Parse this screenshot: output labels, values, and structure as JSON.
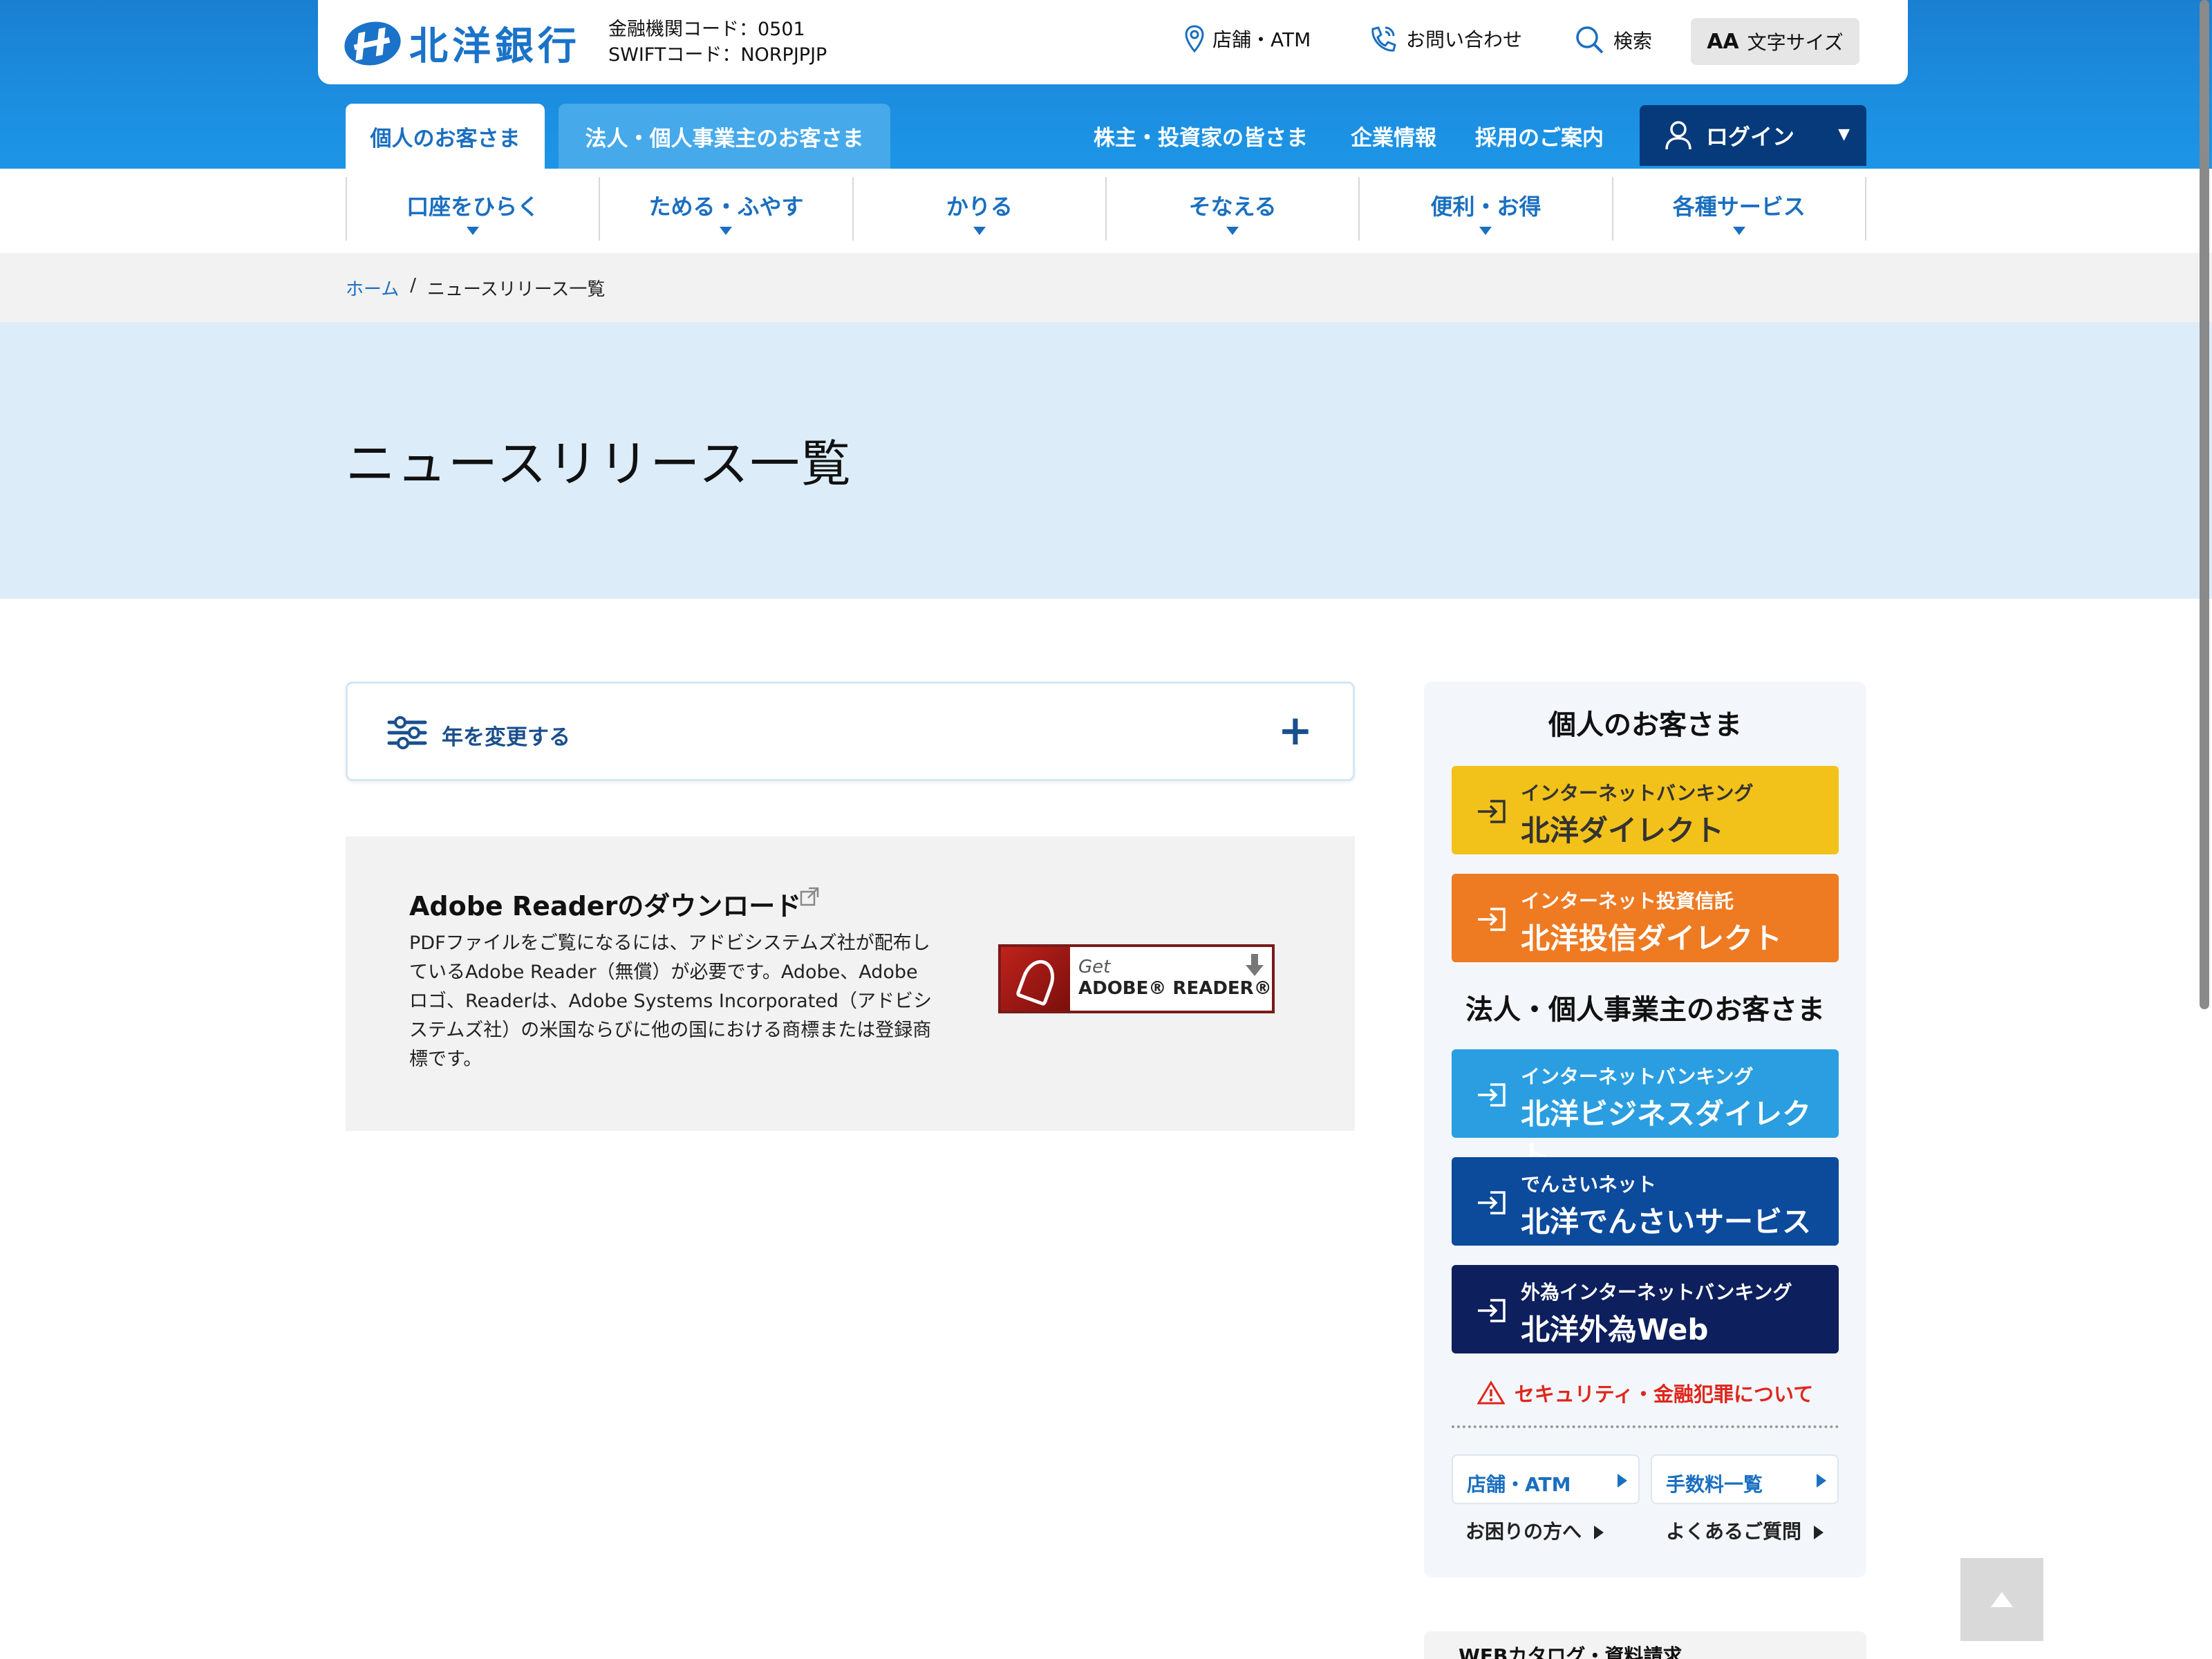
{
  "header": {
    "logo_text": "北洋銀行",
    "bank_code": "金融機関コード：0501",
    "swift_code": "SWIFTコード：NORPJPJP",
    "util_store": "店舗・ATM",
    "util_contact": "お問い合わせ",
    "util_search": "検索",
    "util_fontsize_aa": "AA",
    "util_fontsize": "文字サイズ"
  },
  "tabs": {
    "personal": "個人のお客さま",
    "corporate": "法人・個人事業主のお客さま"
  },
  "toplinks": {
    "investors": "株主・投資家の皆さま",
    "company": "企業情報",
    "recruit": "採用のご案内",
    "login": "ログイン"
  },
  "gnav": [
    {
      "label": "口座をひらく"
    },
    {
      "label": "ためる・ふやす"
    },
    {
      "label": "かりる"
    },
    {
      "label": "そなえる"
    },
    {
      "label": "便利・お得"
    },
    {
      "label": "各種サービス"
    }
  ],
  "breadcrumb": {
    "home": "ホーム",
    "sep": "/",
    "current": "ニュースリリース一覧"
  },
  "page_title": "ニュースリリース一覧",
  "year_selector": {
    "label": "年を変更する",
    "toggle": "+"
  },
  "adobe": {
    "title": "Adobe Readerのダウンロード",
    "body": "PDFファイルをご覧になるには、アドビシステムズ社が配布しているAdobe Reader（無償）が必要です。Adobe、Adobe ロゴ、Readerは、Adobe Systems Incorporated（アドビシステムズ社）の米国ならびに他の国における商標または登録商標です。",
    "badge_get": "Get",
    "badge_reader": "ADOBE® READER®"
  },
  "side": {
    "personal_heading": "個人のお客さま",
    "corporate_heading": "法人・個人事業主のお客さま",
    "buttons": [
      {
        "sub": "インターネットバンキング",
        "main": "北洋ダイレクト",
        "color": "#f2c21b"
      },
      {
        "sub": "インターネット投資信託",
        "main": "北洋投信ダイレクト",
        "color": "#ee7a22"
      },
      {
        "sub": "インターネットバンキング",
        "main": "北洋ビジネスダイレクト",
        "color": "#2a9ee0"
      },
      {
        "sub": "でんさいネット",
        "main": "北洋でんさいサービス",
        "color": "#0c4a9c"
      },
      {
        "sub": "外為インターネットバンキング",
        "main": "北洋外為Web",
        "color": "#0d1f5c"
      }
    ],
    "security": "セキュリティ・金融犯罪について",
    "store_atm": "店舗・ATM",
    "fees": "手数料一覧",
    "help": "お困りの方へ",
    "faq": "よくあるご質問"
  },
  "catalog": "WEBカタログ・資料請求",
  "colors": {
    "brand_blue": "#1a73c8",
    "login_navy": "#063a7a",
    "hero_bg": "#dcecf9",
    "alert_red": "#e0261d"
  },
  "icons": [
    "pin-icon",
    "phone-icon",
    "search-icon",
    "user-icon",
    "filter-icon",
    "external-link-icon",
    "enter-icon",
    "warning-icon",
    "arrow-up-icon"
  ]
}
